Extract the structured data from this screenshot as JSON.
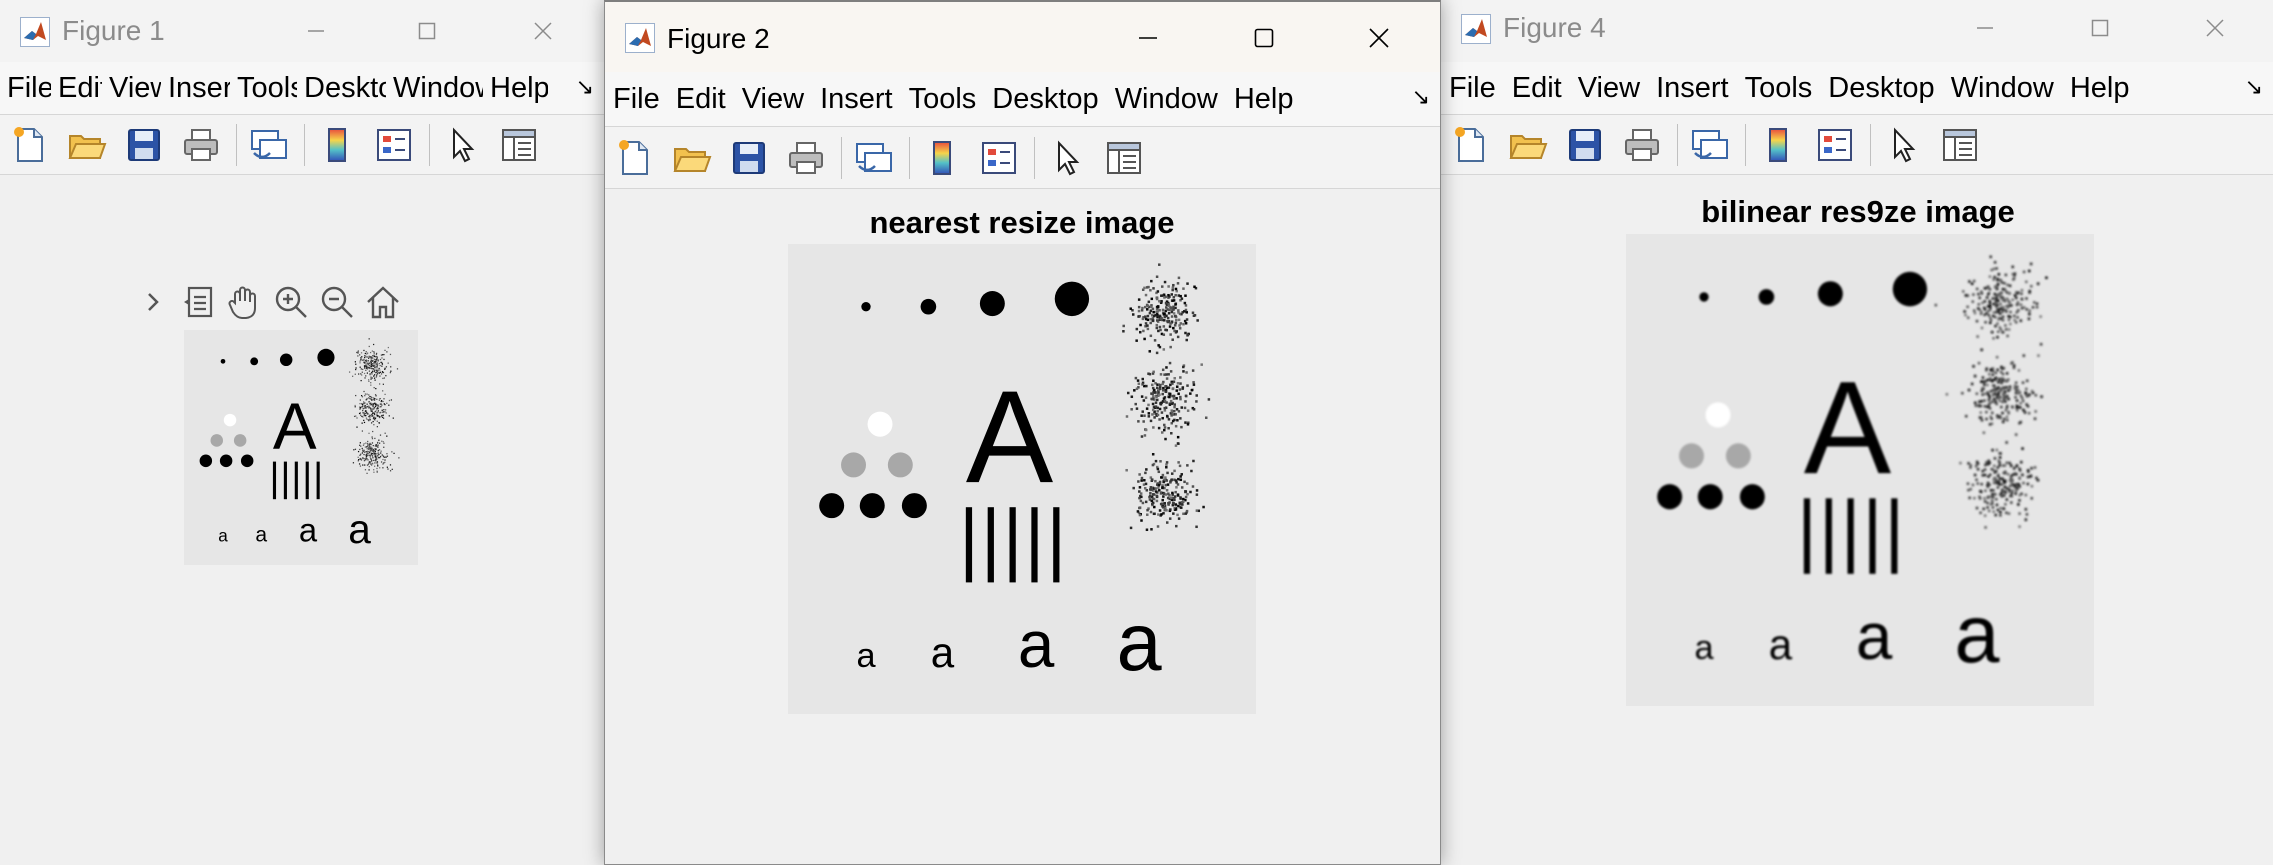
{
  "windows": [
    {
      "id": "fig1",
      "title": "Figure 1",
      "menus": [
        "File",
        "Edit",
        "View",
        "Insert",
        "Tools",
        "Desktop",
        "Window",
        "Help"
      ],
      "plot_title": ""
    },
    {
      "id": "fig2",
      "title": "Figure 2",
      "menus": [
        "File",
        "Edit",
        "View",
        "Insert",
        "Tools",
        "Desktop",
        "Window",
        "Help"
      ],
      "plot_title": "nearest resize image"
    },
    {
      "id": "fig4",
      "title": "Figure 4",
      "menus": [
        "File",
        "Edit",
        "View",
        "Insert",
        "Tools",
        "Desktop",
        "Window",
        "Help"
      ],
      "plot_title": "bilinear res9ze image"
    }
  ],
  "image_content": {
    "big_letter": "A",
    "small_letters": [
      "a",
      "a",
      "a",
      "a"
    ]
  },
  "toolbar_icons": [
    "new-figure-icon",
    "open-file-icon",
    "save-icon",
    "print-icon",
    "link-plot-icon",
    "colorbar-icon",
    "legend-icon",
    "edit-plot-arrow-icon",
    "property-inspector-icon"
  ],
  "axes_toolbar_icons": [
    "expand-arrow-icon",
    "data-tips-icon",
    "pan-hand-icon",
    "zoom-in-icon",
    "zoom-out-icon",
    "restore-view-home-icon"
  ],
  "colors": {
    "window_bg": "#f0f0f0",
    "image_bg": "#e6e6e6",
    "active_title_bg": "#f9f6f2",
    "inactive_title_text": "#8b8b8b"
  }
}
